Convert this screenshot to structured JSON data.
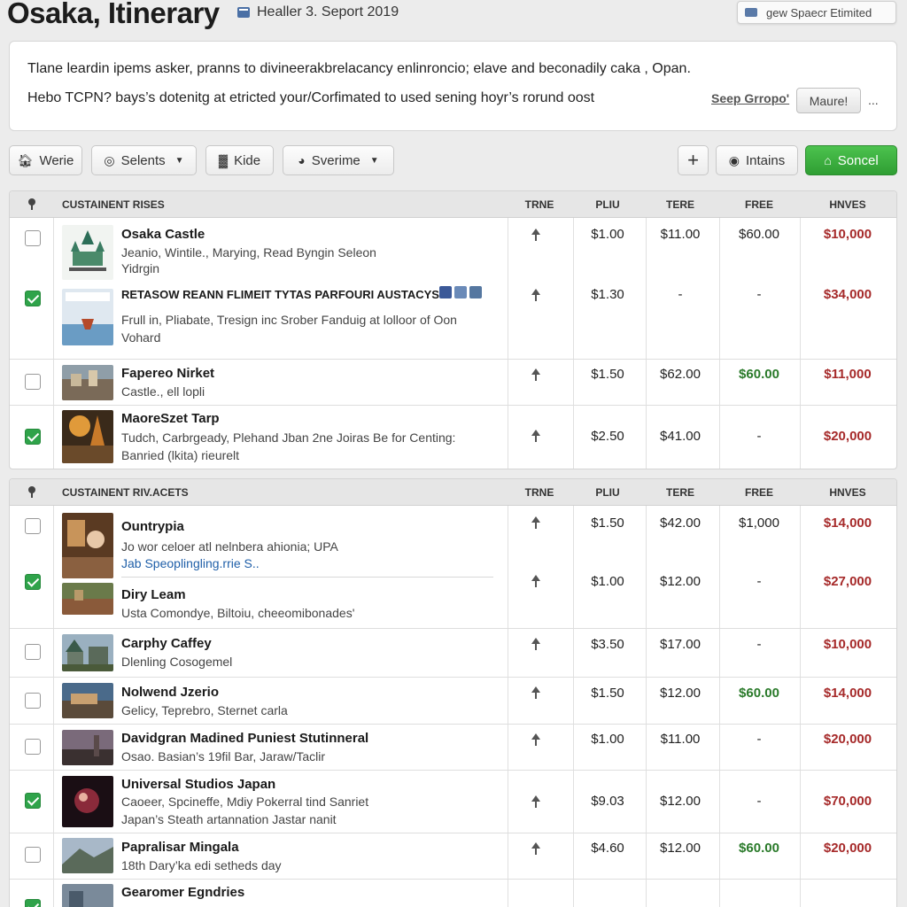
{
  "header": {
    "title": "Osaka, Itinerary",
    "subtitle": "Healler 3. Seport 2019",
    "right_label": "gew Spaecr Etimited"
  },
  "description": {
    "line1": "Tlane leardin ipems asker, pranns to divineerakbrelacancy enlinroncio; elave and beconadily caka , Opan.",
    "line2": "Hebo TCPN? bays’s dotenitg at etricted your/Corfimated to used sening hoyr’s rorund oost",
    "link": "Seep Grropo'",
    "button": "Maure!",
    "more": "..."
  },
  "toolbar": {
    "buttons": [
      {
        "label": "Werie",
        "icon": "building-icon"
      },
      {
        "label": "Selents",
        "icon": "location-pin-icon",
        "dropdown": true
      },
      {
        "label": "Kide",
        "icon": "bar-chart-icon"
      },
      {
        "label": "Sverime",
        "icon": "clock-icon",
        "dropdown": true
      }
    ],
    "add": "+",
    "intains": "Intains",
    "primary": "Soncel"
  },
  "columns": {
    "name": "CUSTAINENT RISES",
    "name2": "CUSTAINENT RIV.ACETS",
    "c1": "TRNE",
    "c2": "PLIU",
    "c3": "TERE",
    "c4": "FREE",
    "c5": "HNVES"
  },
  "table1": [
    {
      "title": "Osaka Castle",
      "sub1": "Jeanio, Wintile., Marying, Read Byngin Seleon",
      "sub2": "Yidrgin",
      "checked": false,
      "c2": "$1.00",
      "c3": "$11.00",
      "c4": "$60.00",
      "c5": "$10,000",
      "c4color": "normal"
    },
    {
      "title": "RETASOW REANN FLIMEIT TYTAS PARFOURI AUSTACYS",
      "sub1": "Frull in, Pliabate, Tresign inc Srober Fanduig at lolloor of Oon",
      "sub2": "Vohard",
      "checked": true,
      "c2": "$1.30",
      "c3": "-",
      "c4": "-",
      "c5": "$34,000",
      "c4color": "normal"
    },
    {
      "title": "Fapereo Nirket",
      "sub1": "Castle., ell lopli",
      "sub2": "",
      "checked": false,
      "c2": "$1.50",
      "c3": "$62.00",
      "c4": "$60.00",
      "c5": "$11,000",
      "c4color": "green"
    },
    {
      "title": "MaoreSzet Tarp",
      "sub1": "Tudch, Carbrgeady, Plehand Jban 2ne Joiras Be for Centing:",
      "sub2": "Banried (lkita) rieurelt",
      "checked": true,
      "c2": "$2.50",
      "c3": "$41.00",
      "c4": "-",
      "c5": "$20,000",
      "c4color": "normal"
    }
  ],
  "table2": [
    {
      "title": "Ountrypia",
      "sub1": "Jo wor celoer atl nelnbera ahionia; UPA",
      "link": "Jab Speoplingling.rrie S..",
      "checked": false,
      "c2": "$1.50",
      "c3": "$42.00",
      "c4": "$1,000",
      "c5": "$14,000",
      "c4color": "normal"
    },
    {
      "title": "Diry Leam",
      "sub1": "Usta Comondye, Biltoiu, cheeomibonades'",
      "checked": true,
      "c2": "$1.00",
      "c3": "$12.00",
      "c4": "-",
      "c5": "$27,000",
      "c4color": "normal"
    },
    {
      "title": "Carphy Caffey",
      "sub1": "Dlenling Cosogemel",
      "checked": false,
      "c2": "$3.50",
      "c3": "$17.00",
      "c4": "-",
      "c5": "$10,000",
      "c4color": "normal"
    },
    {
      "title": "Nolwend Jzerio",
      "sub1": "Gelicy, Teprebro, Sternet carla",
      "checked": false,
      "c2": "$1.50",
      "c3": "$12.00",
      "c4": "$60.00",
      "c5": "$14,000",
      "c4color": "green"
    },
    {
      "title": "Davidgran Madined Puniest Stutinneral",
      "sub1": "Osao. Basian’s 19fil Bar, Jaraw/Taclir",
      "checked": false,
      "c2": "$1.00",
      "c3": "$11.00",
      "c4": "-",
      "c5": "$20,000",
      "c4color": "normal"
    },
    {
      "title": "Universal Studios Japan",
      "sub1": "Caoeer, Spcineffe, Mdiy Pokerral tind Sanriet",
      "sub2": "Japan’s Steath artannation Jastar nanit",
      "checked": true,
      "c2": "$9.03",
      "c3": "$12.00",
      "c4": "-",
      "c5": "$70,000",
      "c4color": "normal"
    },
    {
      "title": "Papralisar Mingala",
      "sub1": "18th Dary’ka edi setheds day",
      "checked": false,
      "c2": "$4.60",
      "c3": "$12.00",
      "c4": "$60.00",
      "c5": "$20,000",
      "c4color": "green"
    },
    {
      "title": "Gearomer Egndries",
      "checked": true
    }
  ],
  "colors": {
    "price_red": "#a62a2a",
    "price_green": "#2a7a2a",
    "check_green": "#2fa34a",
    "primary_button": "#3aa93d"
  }
}
